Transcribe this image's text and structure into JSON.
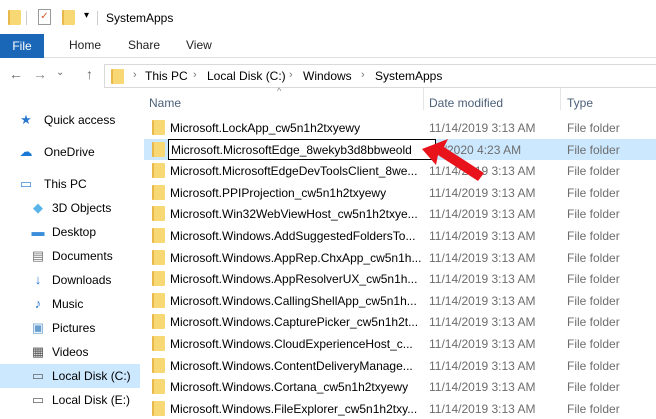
{
  "window": {
    "title": "SystemApps"
  },
  "ribbon": {
    "tabs": [
      "File",
      "Home",
      "Share",
      "View"
    ]
  },
  "address": {
    "crumbs": [
      "This PC",
      "Local Disk (C:)",
      "Windows",
      "SystemApps"
    ],
    "separator": "›"
  },
  "nav": {
    "back": "←",
    "forward": "→",
    "recent": "⌄",
    "up": "↑"
  },
  "sidebar": {
    "items": [
      {
        "label": "Quick access",
        "icon": "star-icon"
      },
      {
        "label": "OneDrive",
        "icon": "cloud-icon"
      },
      {
        "label": "This PC",
        "icon": "computer-icon"
      },
      {
        "label": "3D Objects",
        "icon": "cube-icon"
      },
      {
        "label": "Desktop",
        "icon": "desktop-icon"
      },
      {
        "label": "Documents",
        "icon": "document-icon"
      },
      {
        "label": "Downloads",
        "icon": "download-icon"
      },
      {
        "label": "Music",
        "icon": "music-icon"
      },
      {
        "label": "Pictures",
        "icon": "picture-icon"
      },
      {
        "label": "Videos",
        "icon": "video-icon"
      },
      {
        "label": "Local Disk (C:)",
        "icon": "drive-icon",
        "selected": true
      },
      {
        "label": "Local Disk (E:)",
        "icon": "drive-icon"
      }
    ]
  },
  "columns": {
    "name": "Name",
    "date": "Date modified",
    "type": "Type"
  },
  "files": [
    {
      "name": "Microsoft.LockApp_cw5n1h2txyewy",
      "date": "11/14/2019 3:13 AM",
      "type": "File folder"
    },
    {
      "name": "Microsoft.MicrosoftEdge_8wekyb3d8bbweold",
      "date": "6/2020 4:23 AM",
      "type": "File folder",
      "renaming": true
    },
    {
      "name": "Microsoft.MicrosoftEdgeDevToolsClient_8we...",
      "date": "11/14/2019 3:13 AM",
      "type": "File folder"
    },
    {
      "name": "Microsoft.PPIProjection_cw5n1h2txyewy",
      "date": "11/14/2019 3:13 AM",
      "type": "File folder"
    },
    {
      "name": "Microsoft.Win32WebViewHost_cw5n1h2txye...",
      "date": "11/14/2019 3:13 AM",
      "type": "File folder"
    },
    {
      "name": "Microsoft.Windows.AddSuggestedFoldersTo...",
      "date": "11/14/2019 3:13 AM",
      "type": "File folder"
    },
    {
      "name": "Microsoft.Windows.AppRep.ChxApp_cw5n1h...",
      "date": "11/14/2019 3:13 AM",
      "type": "File folder"
    },
    {
      "name": "Microsoft.Windows.AppResolverUX_cw5n1h...",
      "date": "11/14/2019 3:13 AM",
      "type": "File folder"
    },
    {
      "name": "Microsoft.Windows.CallingShellApp_cw5n1h...",
      "date": "11/14/2019 3:13 AM",
      "type": "File folder"
    },
    {
      "name": "Microsoft.Windows.CapturePicker_cw5n1h2t...",
      "date": "11/14/2019 3:13 AM",
      "type": "File folder"
    },
    {
      "name": "Microsoft.Windows.CloudExperienceHost_c...",
      "date": "11/14/2019 3:13 AM",
      "type": "File folder"
    },
    {
      "name": "Microsoft.Windows.ContentDeliveryManage...",
      "date": "11/14/2019 3:13 AM",
      "type": "File folder"
    },
    {
      "name": "Microsoft.Windows.Cortana_cw5n1h2txyewy",
      "date": "11/14/2019 3:13 AM",
      "type": "File folder"
    },
    {
      "name": "Microsoft.Windows.FileExplorer_cw5n1h2txy...",
      "date": "11/14/2019 3:13 AM",
      "type": "File folder"
    }
  ],
  "colors": {
    "accent": "#1a67b8",
    "selection": "#cce8ff",
    "arrow": "#e8131b",
    "folder": "#f8d775"
  }
}
